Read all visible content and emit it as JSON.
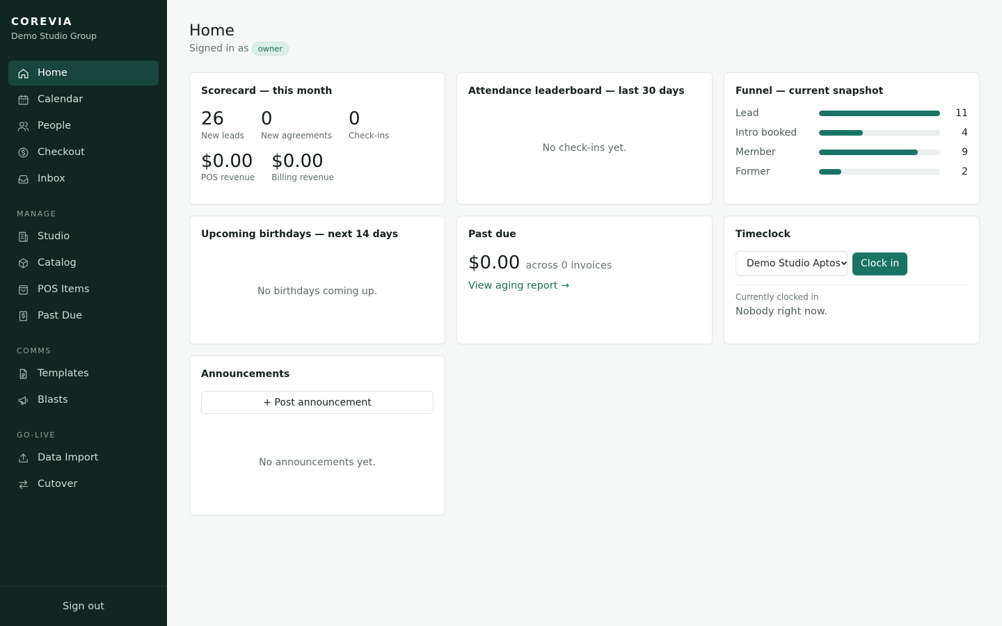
{
  "brand": {
    "name": "COREVIA",
    "org": "Demo Studio Group"
  },
  "nav": {
    "primary": [
      {
        "label": "Home",
        "icon": "home-icon",
        "active": true
      },
      {
        "label": "Calendar",
        "icon": "calendar-icon"
      },
      {
        "label": "People",
        "icon": "people-icon"
      },
      {
        "label": "Checkout",
        "icon": "dollar-circle-icon"
      },
      {
        "label": "Inbox",
        "icon": "inbox-icon"
      }
    ],
    "manage_label": "MANAGE",
    "manage": [
      {
        "label": "Studio",
        "icon": "building-icon"
      },
      {
        "label": "Catalog",
        "icon": "box-icon"
      },
      {
        "label": "POS Items",
        "icon": "bag-icon"
      },
      {
        "label": "Past Due",
        "icon": "invoice-dollar-icon"
      }
    ],
    "comms_label": "COMMS",
    "comms": [
      {
        "label": "Templates",
        "icon": "document-icon"
      },
      {
        "label": "Blasts",
        "icon": "megaphone-icon"
      }
    ],
    "golive_label": "GO-LIVE",
    "golive": [
      {
        "label": "Data Import",
        "icon": "upload-icon"
      },
      {
        "label": "Cutover",
        "icon": "swap-arrows-icon"
      }
    ],
    "signout": "Sign out"
  },
  "header": {
    "title": "Home",
    "signed_in_as": "Signed in as",
    "role": "owner"
  },
  "scorecard": {
    "title": "Scorecard — this month",
    "new_leads": {
      "value": "26",
      "label": "New leads"
    },
    "new_agreements": {
      "value": "0",
      "label": "New agreements"
    },
    "checkins": {
      "value": "0",
      "label": "Check-ins"
    },
    "pos_revenue": {
      "value": "$0.00",
      "label": "POS revenue"
    },
    "billing_revenue": {
      "value": "$0.00",
      "label": "Billing revenue"
    }
  },
  "attendance": {
    "title": "Attendance leaderboard — last 30 days",
    "empty": "No check-ins yet."
  },
  "funnel": {
    "title": "Funnel — current snapshot",
    "rows": [
      {
        "label": "Lead",
        "count": "11",
        "value": 11
      },
      {
        "label": "Intro booked",
        "count": "4",
        "value": 4
      },
      {
        "label": "Member",
        "count": "9",
        "value": 9
      },
      {
        "label": "Former",
        "count": "2",
        "value": 2
      }
    ],
    "max": 11,
    "bar_color": "#1a7464"
  },
  "birthdays": {
    "title": "Upcoming birthdays — next 14 days",
    "empty": "No birthdays coming up."
  },
  "past_due": {
    "title": "Past due",
    "amount": "$0.00",
    "note": "across 0 invoices",
    "link": "View aging report →"
  },
  "timeclock": {
    "title": "Timeclock",
    "location": "Demo Studio Aptos",
    "button": "Clock in",
    "caption": "Currently clocked in",
    "status": "Nobody right now."
  },
  "announcements": {
    "title": "Announcements",
    "post_button": "+ Post announcement",
    "empty": "No announcements yet."
  },
  "colors": {
    "sidebar_bg": "#0f2621",
    "accent": "#1a7464",
    "active_nav": "#18463c"
  }
}
